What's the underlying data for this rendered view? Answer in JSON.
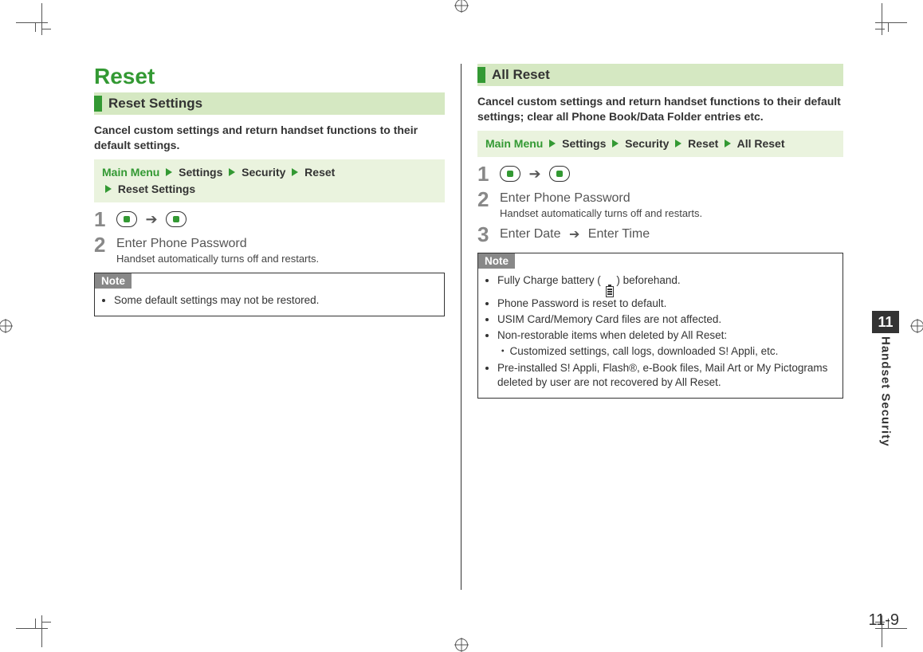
{
  "page": {
    "chapter_number": "11",
    "chapter_title": "Handset Security",
    "page_number": "11-9"
  },
  "left": {
    "title": "Reset",
    "section": "Reset Settings",
    "intro": "Cancel custom settings and return handset functions to their default settings.",
    "breadcrumb": {
      "root": "Main Menu",
      "p1": "Settings",
      "p2": "Security",
      "p3": "Reset",
      "p4": "Reset Settings"
    },
    "steps": {
      "s1_num": "1",
      "s2_num": "2",
      "s2_title": "Enter Phone Password",
      "s2_sub": "Handset automatically turns off and restarts."
    },
    "note": {
      "label": "Note",
      "n1": "Some default settings may not be restored."
    }
  },
  "right": {
    "section": "All Reset",
    "intro": "Cancel custom settings and return handset functions to their default settings; clear all Phone Book/Data Folder entries etc.",
    "breadcrumb": {
      "root": "Main Menu",
      "p1": "Settings",
      "p2": "Security",
      "p3": "Reset",
      "p4": "All Reset"
    },
    "steps": {
      "s1_num": "1",
      "s2_num": "2",
      "s2_title": "Enter Phone Password",
      "s2_sub": "Handset automatically turns off and restarts.",
      "s3_num": "3",
      "s3_a": "Enter Date",
      "s3_b": "Enter Time"
    },
    "note": {
      "label": "Note",
      "n1a": "Fully Charge battery (",
      "n1b": ") beforehand.",
      "n2": "Phone Password is reset to default.",
      "n3": "USIM Card/Memory Card files are not affected.",
      "n4": "Non-restorable items when deleted by All Reset:",
      "n4a": "Customized settings, call logs, downloaded S! Appli, etc.",
      "n5": "Pre-installed S! Appli, Flash®, e-Book files, Mail Art or My Pictograms deleted by user are not recovered by All Reset."
    }
  }
}
